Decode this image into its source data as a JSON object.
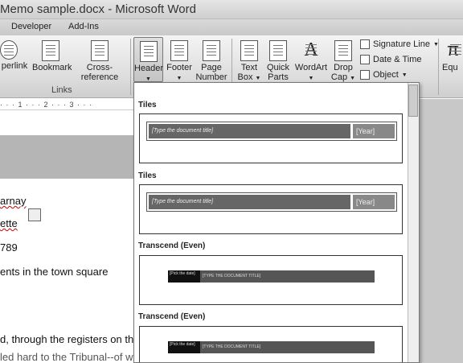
{
  "window": {
    "title": "Memo sample.docx - Microsoft Word"
  },
  "tabs": [
    "Developer",
    "Add-Ins"
  ],
  "ribbon": {
    "links_group": {
      "label": "Links",
      "hyperlink": "perlink",
      "bookmark": "Bookmark",
      "crossref": "Cross-reference"
    },
    "header": "Header",
    "footer": "Footer",
    "page_number_1": "Page",
    "page_number_2": "Number",
    "text_box_1": "Text",
    "text_box_2": "Box",
    "quick_parts_1": "Quick",
    "quick_parts_2": "Parts",
    "wordart": "WordArt",
    "drop_cap_1": "Drop",
    "drop_cap_2": "Cap",
    "signature_line": "Signature Line",
    "date_time": "Date & Time",
    "object": "Object",
    "equation_partial": "Equ"
  },
  "ruler": {
    "text": "· · · 1 · · · 2 · · · 3 · · ·"
  },
  "document": {
    "line1": "arnay",
    "line2": "ette",
    "line3": "789",
    "line4": "ents in the town square",
    "line5": "d, through the registers on the",
    "line6": "led hard to the Tribunal--of whe"
  },
  "gallery": {
    "sections": [
      {
        "title": "Tiles",
        "doc_title": "[Type the document title]",
        "year": "[Year]"
      },
      {
        "title": "Tiles",
        "doc_title": "[Type the document title]",
        "year": "[Year]"
      },
      {
        "title": "Transcend (Even)",
        "date": "[Pick the date]",
        "doc_title": "[TYPE THE DOCUMENT TITLE]"
      },
      {
        "title": "Transcend (Even)",
        "date": "[Pick the date]",
        "doc_title": "[TYPE THE DOCUMENT TITLE]"
      }
    ]
  }
}
